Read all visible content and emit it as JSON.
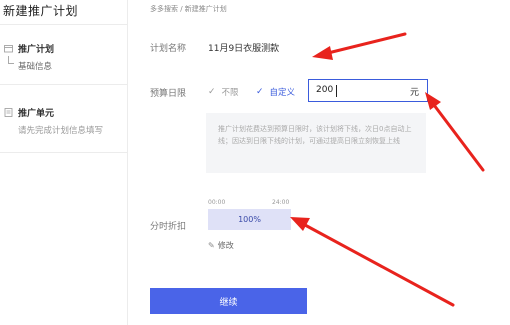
{
  "sidebar": {
    "title": "新建推广计划",
    "groups": [
      {
        "title": "推广计划",
        "sub": "基础信息"
      },
      {
        "title": "推广单元",
        "sub": "请先完成计划信息填写"
      }
    ]
  },
  "breadcrumb": "多多搜索 / 新建推广计划",
  "form": {
    "plan_name_label": "计划名称",
    "plan_name_value": "11月9日衣服测款",
    "budget_label": "预算日限",
    "budget_unlimited": "不限",
    "budget_custom": "自定义",
    "budget_value": "200",
    "budget_unit": "元",
    "budget_hint": "推广计划花费达到预算日限时，该计划将下线，次日0点自动上线；因达到日限下线的计划，可通过提高日限立刻恢复上线",
    "timeslot_label": "分时折扣",
    "time_start": "00:00",
    "time_end": "24:00",
    "discount_value": "100%",
    "edit_label": "修改",
    "continue_label": "继续"
  },
  "icons": {
    "plan_group": "folder-icon",
    "unit_group": "document-icon",
    "check": "check-icon",
    "edit": "edit-icon"
  },
  "colors": {
    "accent": "#3a5bdc",
    "button": "#4a64e8",
    "annotation": "#e8231d",
    "time_bar": "#dfe1f7"
  }
}
